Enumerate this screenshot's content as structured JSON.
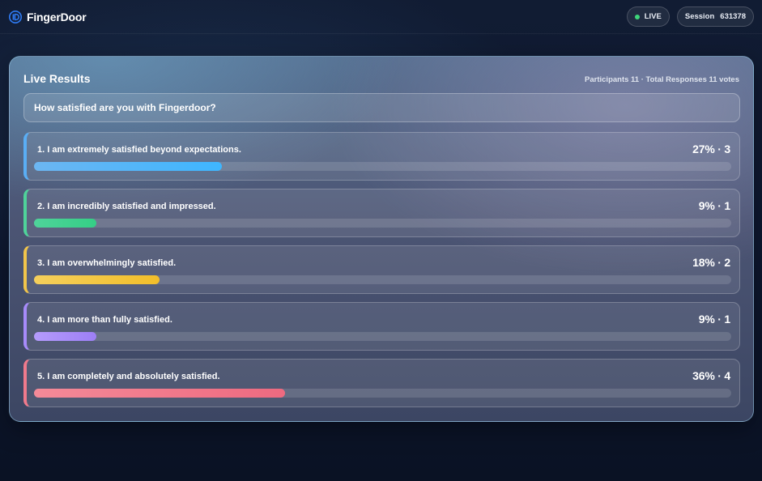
{
  "header": {
    "brand_name": "FingerDoor",
    "live_label": "LIVE",
    "session_label": "Session",
    "session_id": "631378"
  },
  "results": {
    "title": "Live Results",
    "stats": "Participants 11 · Total Responses 11 votes",
    "question": "How satisfied are you with Fingerdoor?",
    "options": [
      {
        "label": "1. I am extremely satisfied beyond expectations.",
        "result": "27% · 3",
        "percent": 27,
        "votes": 3,
        "accent": "#5aaef5",
        "accent_light": "#6cb6f2",
        "accent_dark": "#3eb6ff"
      },
      {
        "label": "2. I am incredibly satisfied and impressed.",
        "result": "9% · 1",
        "percent": 9,
        "votes": 1,
        "accent": "#4fd39a",
        "accent_light": "#4fd39a",
        "accent_dark": "#35cf86"
      },
      {
        "label": "3. I am overwhelmingly satisfied.",
        "result": "18% · 2",
        "percent": 18,
        "votes": 2,
        "accent": "#f2c54a",
        "accent_light": "#f4cf5c",
        "accent_dark": "#f2be2a"
      },
      {
        "label": "4. I am more than fully satisfied.",
        "result": "9% · 1",
        "percent": 9,
        "votes": 1,
        "accent": "#a78bfa",
        "accent_light": "#b49bfc",
        "accent_dark": "#9d7ff6"
      },
      {
        "label": "5. I am completely and absolutely satisfied.",
        "result": "36% · 4",
        "percent": 36,
        "votes": 4,
        "accent": "#f07a8c",
        "accent_light": "#f48a98",
        "accent_dark": "#ee6a80"
      }
    ]
  }
}
